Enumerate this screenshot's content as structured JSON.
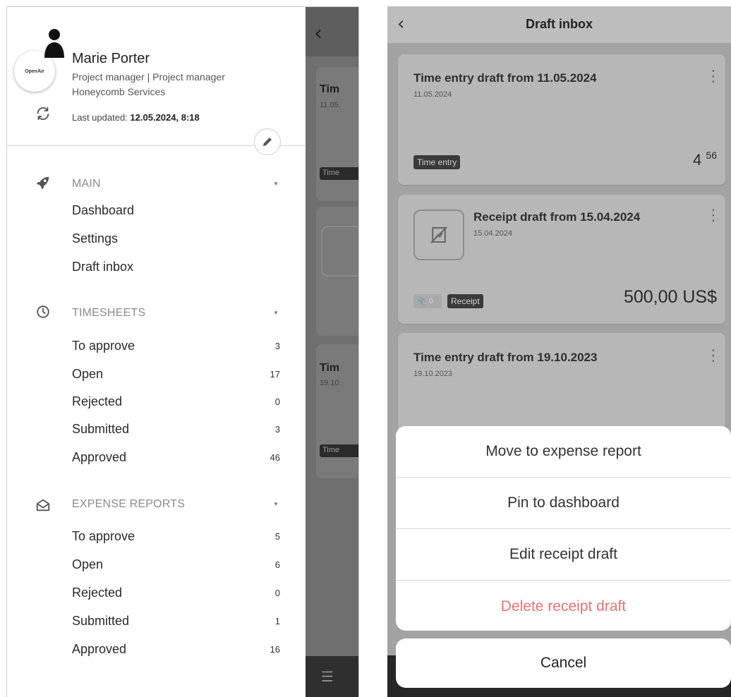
{
  "left_phone": {
    "profile": {
      "logo_text": "OpenAir",
      "name": "Marie Porter",
      "role": "Project manager | Project manager",
      "company": "Honeycomb Services",
      "last_updated_label": "Last updated:",
      "last_updated_value": "12.05.2024, 8:18"
    },
    "sections": {
      "main": {
        "title": "MAIN",
        "items": [
          {
            "label": "Dashboard"
          },
          {
            "label": "Settings"
          },
          {
            "label": "Draft inbox"
          }
        ]
      },
      "timesheets": {
        "title": "TIMESHEETS",
        "items": [
          {
            "label": "To approve",
            "count": "3"
          },
          {
            "label": "Open",
            "count": "17"
          },
          {
            "label": "Rejected",
            "count": "0"
          },
          {
            "label": "Submitted",
            "count": "3"
          },
          {
            "label": "Approved",
            "count": "46"
          }
        ]
      },
      "expense_reports": {
        "title": "EXPENSE REPORTS",
        "items": [
          {
            "label": "To approve",
            "count": "5"
          },
          {
            "label": "Open",
            "count": "6"
          },
          {
            "label": "Rejected",
            "count": "0"
          },
          {
            "label": "Submitted",
            "count": "1"
          },
          {
            "label": "Approved",
            "count": "16"
          }
        ]
      }
    },
    "background_screen": {
      "card1_title": "Tim",
      "card1_date": "11.05.",
      "card1_tag": "Time",
      "card3_title": "Tim",
      "card3_date": "19.10.",
      "card3_tag": "Time"
    }
  },
  "right_phone": {
    "header_title": "Draft inbox",
    "cards": [
      {
        "title": "Time entry draft from 11.05.2024",
        "date": "11.05.2024",
        "tag": "Time entry",
        "amount_main": "4",
        "amount_sup": "56"
      },
      {
        "title": "Receipt draft from 15.04.2024",
        "date": "15.04.2024",
        "attachments": "0",
        "tag": "Receipt",
        "amount": "500,00 US$"
      },
      {
        "title": "Time entry draft from 19.10.2023",
        "date": "19.10.2023"
      }
    ],
    "action_sheet": {
      "items": [
        {
          "label": "Move to expense report"
        },
        {
          "label": "Pin to dashboard"
        },
        {
          "label": "Edit receipt draft"
        },
        {
          "label": "Delete receipt draft"
        }
      ],
      "cancel_label": "Cancel"
    }
  },
  "colors": {
    "danger": "#e57373",
    "overlay": "#6f6f6f",
    "tag_bg": "#3a3a3a"
  },
  "icons": [
    "person-icon",
    "refresh-icon",
    "pencil-icon",
    "rocket-icon",
    "clock-icon",
    "envelope-icon",
    "chevron-left-icon",
    "kebab-icon",
    "no-image-icon",
    "paperclip-icon",
    "hamburger-icon",
    "caret-down-icon"
  ]
}
